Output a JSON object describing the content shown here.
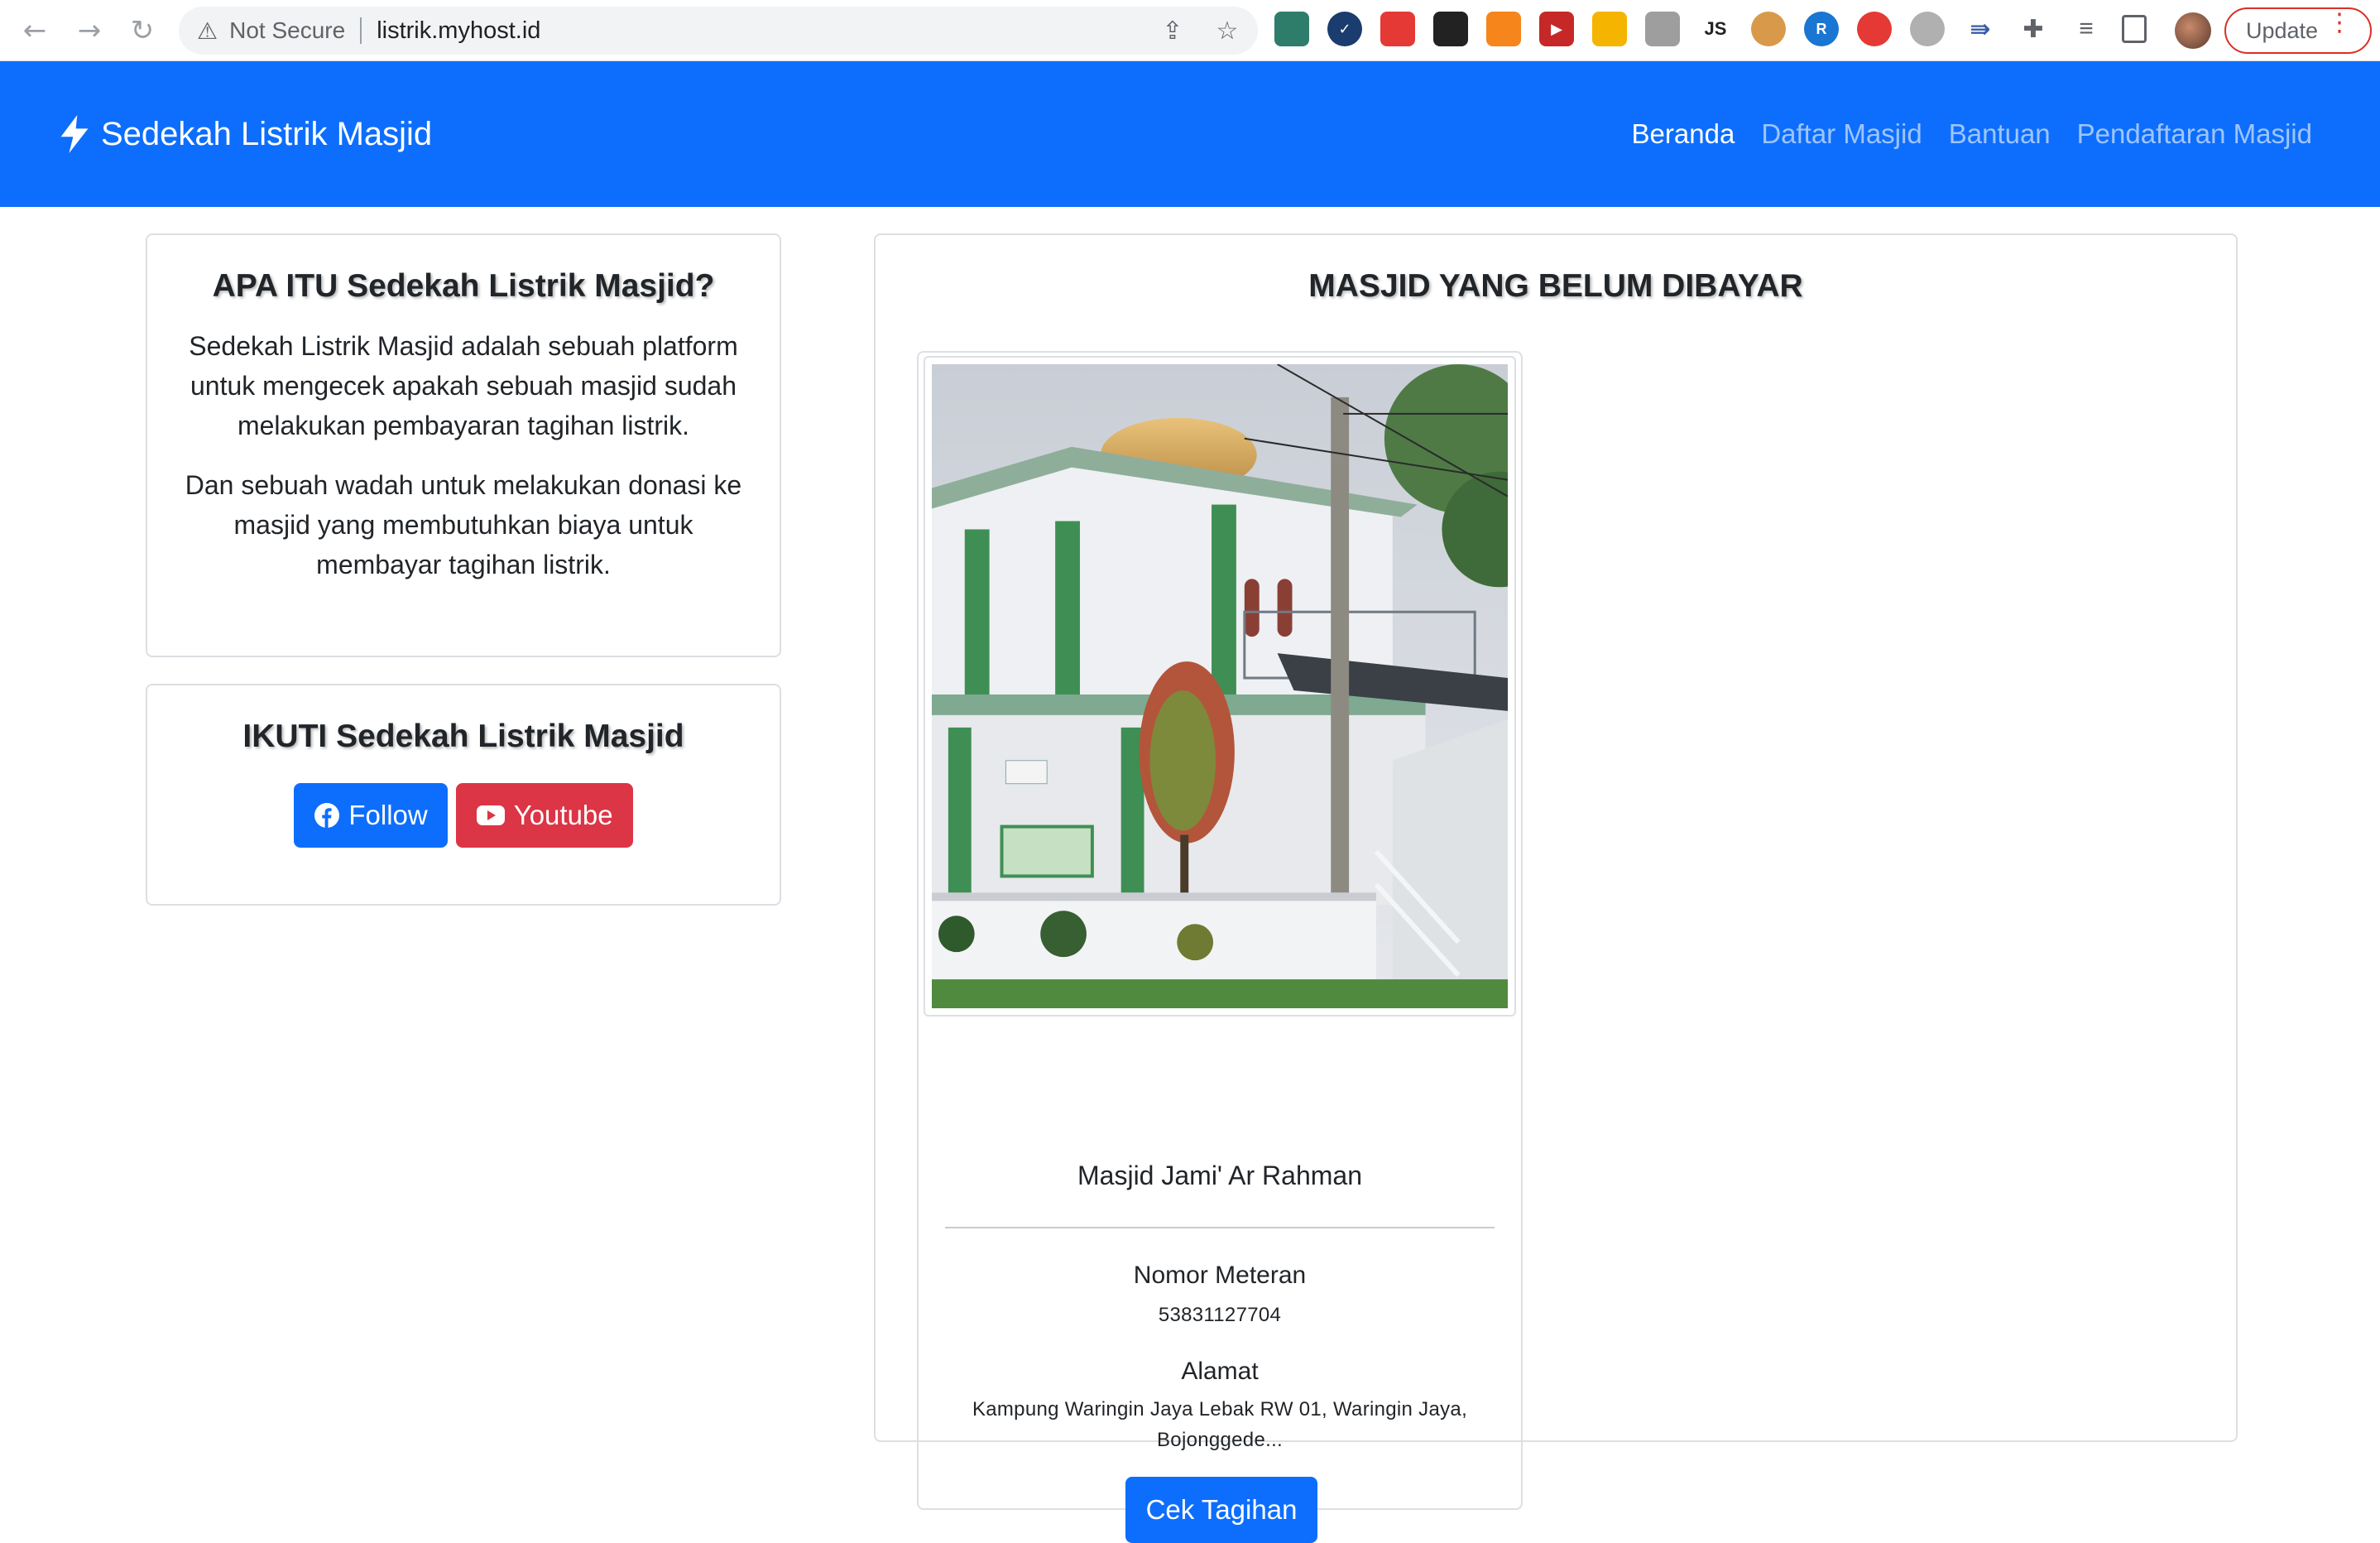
{
  "browser": {
    "security_label": "Not Secure",
    "url": "listrik.myhost.id",
    "update_label": "Update",
    "ext_js_label": "JS"
  },
  "navbar": {
    "brand": "Sedekah Listrik Masjid",
    "links": [
      "Beranda",
      "Daftar Masjid",
      "Bantuan",
      "Pendaftaran Masjid"
    ],
    "active_index": 0
  },
  "about": {
    "title": "APA ITU Sedekah Listrik Masjid?",
    "paragraph1": "Sedekah Listrik Masjid adalah sebuah platform untuk mengecek apakah sebuah masjid sudah melakukan pembayaran tagihan listrik.",
    "paragraph2": "Dan sebuah wadah untuk melakukan donasi ke masjid yang membutuhkan biaya untuk membayar tagihan listrik."
  },
  "follow": {
    "title": "IKUTI Sedekah Listrik Masjid",
    "facebook_label": "Follow",
    "youtube_label": "Youtube"
  },
  "unpaid": {
    "title": "MASJID YANG BELUM DIBAYAR",
    "masjid": {
      "name": "Masjid Jami' Ar Rahman",
      "meter_label": "Nomor Meteran",
      "meter_number": "53831127704",
      "address_label": "Alamat",
      "address": "Kampung Waringin Jaya Lebak RW 01, Waringin Jaya, Bojonggede...",
      "button_label": "Cek Tagihan"
    }
  },
  "colors": {
    "primary": "#0d6efd",
    "danger": "#dc3545",
    "chrome_update_border": "#d93025"
  }
}
